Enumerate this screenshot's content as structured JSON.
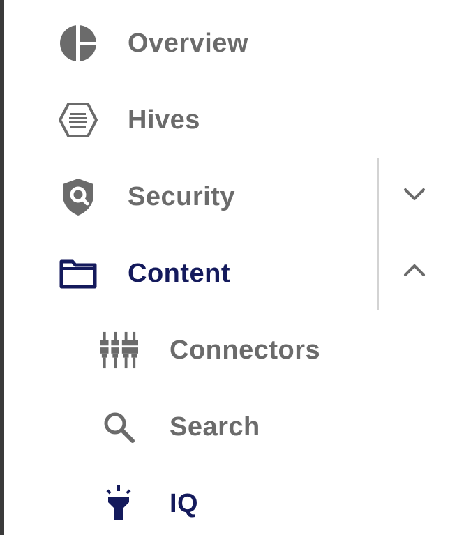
{
  "nav": {
    "items": [
      {
        "label": "Overview",
        "icon": "pie-chart-icon",
        "active": false
      },
      {
        "label": "Hives",
        "icon": "hexagon-list-icon",
        "active": false
      },
      {
        "label": "Security",
        "icon": "shield-search-icon",
        "active": false,
        "expandable": true,
        "expanded": false
      },
      {
        "label": "Content",
        "icon": "folder-icon",
        "active": true,
        "expandable": true,
        "expanded": true
      }
    ],
    "subitems": [
      {
        "label": "Connectors",
        "icon": "connectors-icon",
        "active": false
      },
      {
        "label": "Search",
        "icon": "search-icon",
        "active": false
      },
      {
        "label": "IQ",
        "icon": "flashlight-icon",
        "active": true
      }
    ]
  },
  "colors": {
    "inactive": "#6b6b6b",
    "active": "#141a5c",
    "divider": "#d3d3d3",
    "background": "#ffffff"
  }
}
